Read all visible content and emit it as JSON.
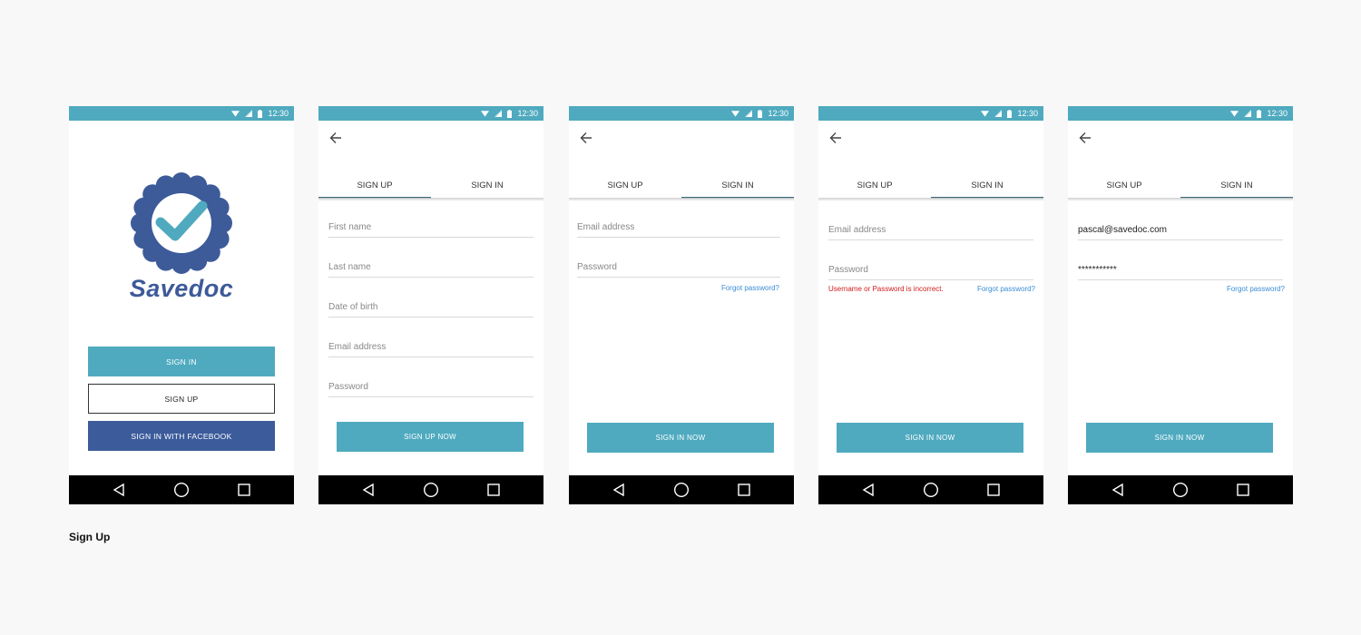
{
  "status_time": "12:30",
  "caption": "Sign Up",
  "colors": {
    "accent": "#4faabf",
    "brand": "#3d5a99",
    "facebook": "#3b5b9b",
    "error": "#d01c1c",
    "link": "#3b8dd6"
  },
  "screen1": {
    "brand": "Savedoc",
    "sign_in_button": "SIGN IN",
    "sign_up_button": "SIGN UP",
    "facebook_button": "SIGN IN WITH FACEBOOK"
  },
  "tabs": {
    "sign_up": "SIGN UP",
    "sign_in": "SIGN IN"
  },
  "screen2": {
    "fields": {
      "first_name": "First name",
      "last_name": "Last name",
      "dob": "Date of birth",
      "email": "Email address",
      "password": "Password"
    },
    "submit": "SIGN UP NOW"
  },
  "screen3": {
    "email_placeholder": "Email address",
    "password_placeholder": "Password",
    "forgot": "Forgot password?",
    "submit": "SIGN IN NOW"
  },
  "screen4": {
    "email_placeholder": "Email address",
    "password_placeholder": "Password",
    "error": "Username or Password is incorrect.",
    "forgot": "Forgot password?",
    "submit": "SIGN IN NOW"
  },
  "screen5": {
    "email_value": "pascal@savedoc.com",
    "password_value": "***********",
    "forgot": "Forgot password?",
    "submit": "SIGN IN NOW"
  }
}
